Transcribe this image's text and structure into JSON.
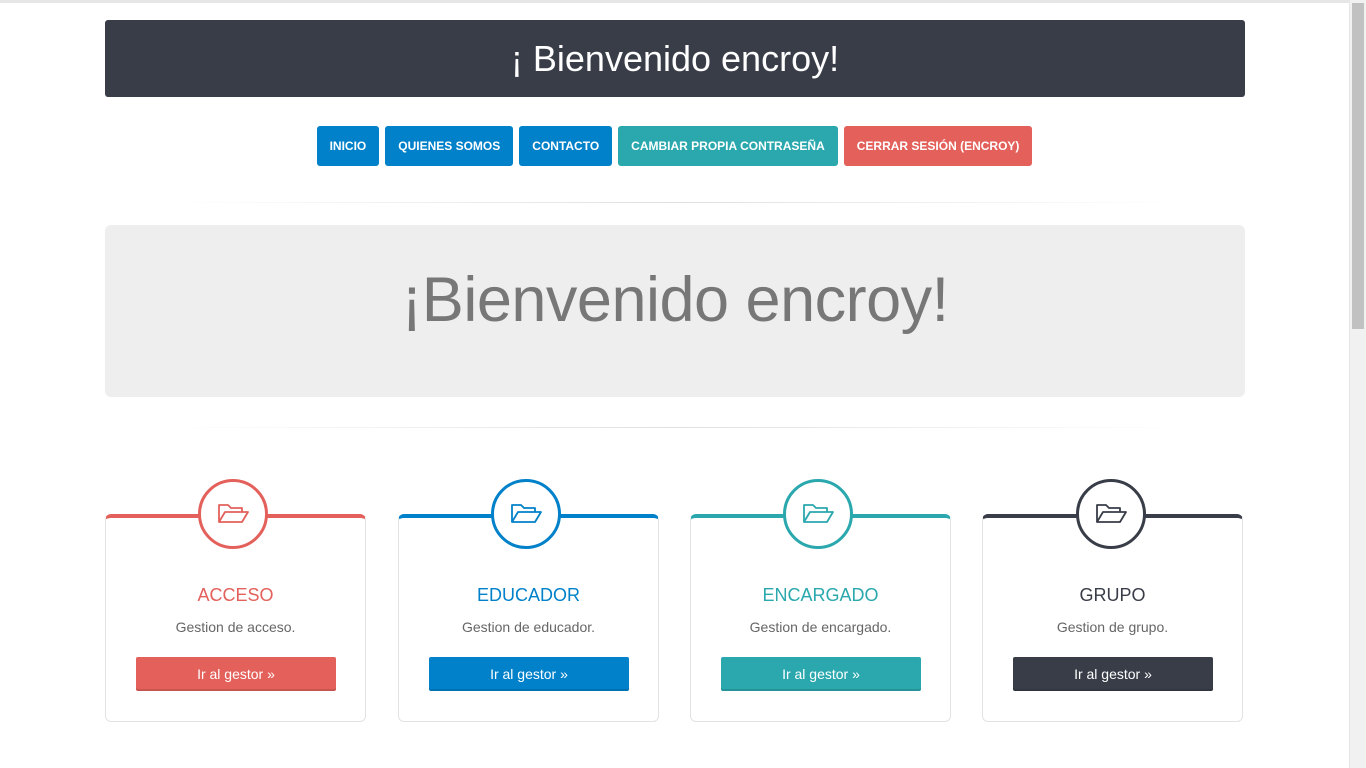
{
  "header": {
    "title": "¡ Bienvenido encroy!"
  },
  "nav": [
    {
      "label": "INICIO",
      "color": "#0181c9"
    },
    {
      "label": "QUIENES SOMOS",
      "color": "#0181c9"
    },
    {
      "label": "CONTACTO",
      "color": "#0181c9"
    },
    {
      "label": "CAMBIAR PROPIA CONTRASEÑA",
      "color": "#2aa8ae"
    },
    {
      "label": "CERRAR SESIÓN (ENCROY)",
      "color": "#e3605b"
    }
  ],
  "jumbotron": {
    "text": "¡Bienvenido encroy!"
  },
  "cards": [
    {
      "title": "ACCESO",
      "description": "Gestion de acceso.",
      "button": "Ir al gestor »",
      "color": "#e3605b",
      "icon": "folder-open-icon"
    },
    {
      "title": "EDUCADOR",
      "description": "Gestion de educador.",
      "button": "Ir al gestor »",
      "color": "#0181c9",
      "icon": "folder-open-icon"
    },
    {
      "title": "ENCARGADO",
      "description": "Gestion de encargado.",
      "button": "Ir al gestor »",
      "color": "#2aa8ae",
      "icon": "folder-open-icon"
    },
    {
      "title": "GRUPO",
      "description": "Gestion de grupo.",
      "button": "Ir al gestor »",
      "color": "#383d48",
      "icon": "folder-open-icon"
    }
  ]
}
